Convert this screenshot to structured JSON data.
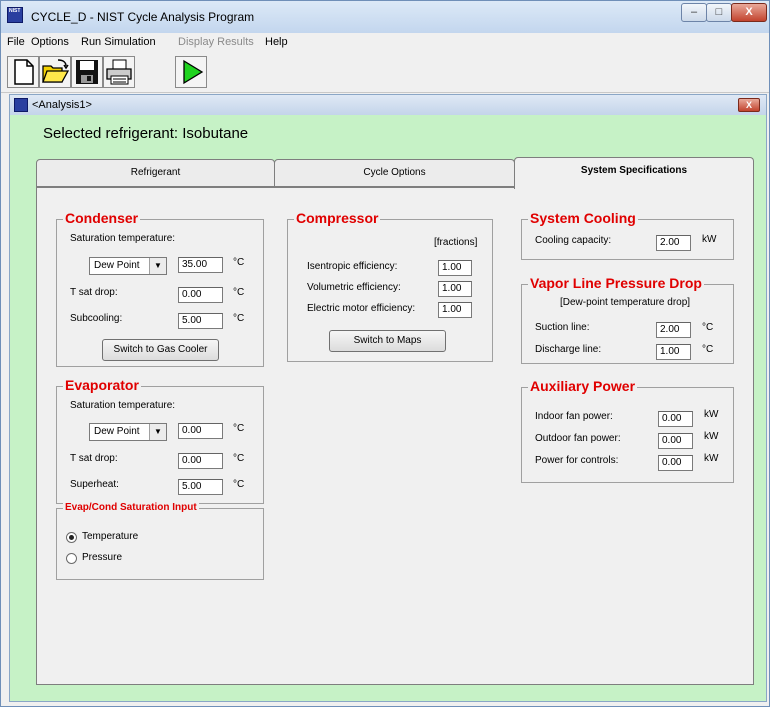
{
  "window": {
    "title": "CYCLE_D - NIST Cycle Analysis Program",
    "app_icon_text": "NIST",
    "min": "–",
    "max": "□",
    "close": "X"
  },
  "menu": [
    "File",
    "Options",
    "Run Simulation",
    "Display Results",
    "Help"
  ],
  "child": {
    "title": "<Analysis1>",
    "close": "X"
  },
  "selected_refrigerant": "Selected refrigerant:  Isobutane",
  "tabs": [
    "Refrigerant",
    "Cycle Options",
    "System Specifications"
  ],
  "condenser": {
    "title": "Condenser",
    "sat_label": "Saturation temperature:",
    "sat_mode": "Dew Point",
    "sat_value": "35.00",
    "unit_c": "°C",
    "tsat_label": "T sat drop:",
    "tsat_value": "0.00",
    "subcool_label": "Subcooling:",
    "subcool_value": "5.00",
    "switch_button": "Switch to Gas Cooler"
  },
  "evaporator": {
    "title": "Evaporator",
    "sat_label": "Saturation temperature:",
    "sat_mode": "Dew Point",
    "sat_value": "0.00",
    "tsat_label": "T sat drop:",
    "tsat_value": "0.00",
    "superheat_label": "Superheat:",
    "superheat_value": "5.00"
  },
  "sat_input": {
    "title": "Evap/Cond Saturation Input",
    "options": [
      "Temperature",
      "Pressure"
    ],
    "selected": "Temperature"
  },
  "compressor": {
    "title": "Compressor",
    "fractions_label": "[fractions]",
    "isentropic_label": "Isentropic efficiency:",
    "isentropic_value": "1.00",
    "volumetric_label": "Volumetric efficiency:",
    "volumetric_value": "1.00",
    "motor_label": "Electric motor efficiency:",
    "motor_value": "1.00",
    "switch_button": "Switch to Maps"
  },
  "system_cooling": {
    "title": "System Cooling",
    "capacity_label": "Cooling capacity:",
    "capacity_value": "2.00",
    "unit": "kW"
  },
  "vapor_line": {
    "title": "Vapor Line Pressure Drop",
    "note": "[Dew-point temperature drop]",
    "suction_label": "Suction line:",
    "suction_value": "2.00",
    "discharge_label": "Discharge line:",
    "discharge_value": "1.00"
  },
  "aux_power": {
    "title": "Auxiliary Power",
    "indoor_label": "Indoor fan power:",
    "indoor_value": "0.00",
    "outdoor_label": "Outdoor fan power:",
    "outdoor_value": "0.00",
    "controls_label": "Power for controls:",
    "controls_value": "0.00",
    "unit": "kW"
  },
  "colors": {
    "accent_red": "#e00000",
    "child_bg": "#c6f2c6",
    "run_green": "#1fd31f"
  },
  "icons": [
    "new-file-icon",
    "open-folder-icon",
    "save-disk-icon",
    "print-icon",
    "run-play-icon"
  ]
}
